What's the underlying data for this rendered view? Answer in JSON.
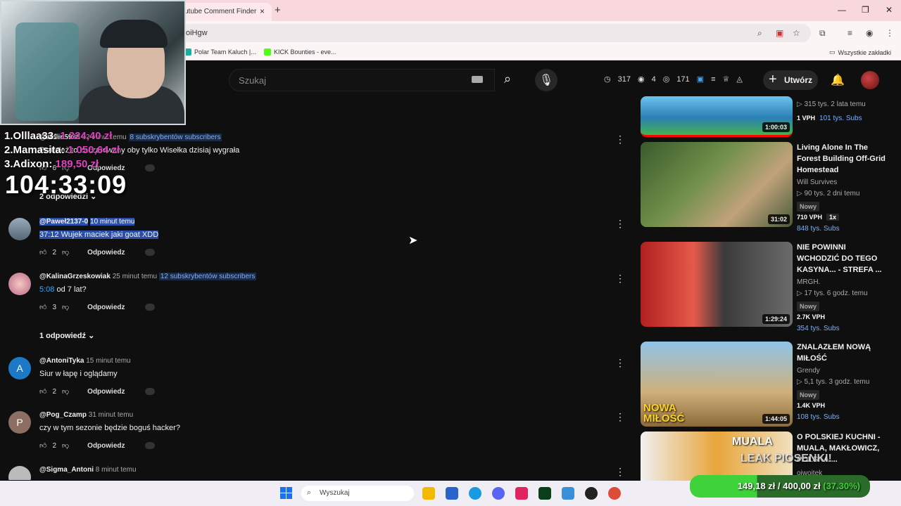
{
  "browser": {
    "tab_title": "utube Comment Finder",
    "address": "oiHgw",
    "bookmarks": [
      "Polar Team Kaluch |...",
      "KICK Bounties - eve..."
    ],
    "all_bookmarks": "Wszystkie zakładki"
  },
  "overlay": {
    "leaderboard": [
      {
        "name": "1.Olllaa33:",
        "amount": "1 324,40 zł"
      },
      {
        "name": "2.Mamasita:",
        "amount": "1 050,64 zł"
      },
      {
        "name": "3.Adixon:",
        "amount": "189,50 zł"
      }
    ],
    "timer": "104:33:09",
    "goal": {
      "current": "149,18 zł",
      "target": "400,00 zł",
      "percent": "(37.30%)",
      "progress": 0.373
    },
    "leak_text": "LEAK PIOSENKI!"
  },
  "header": {
    "search_placeholder": "Szukaj",
    "stats": {
      "a": "317",
      "b": "4",
      "c": "171"
    },
    "create_label": "Utwórz"
  },
  "comments": [
    {
      "author": "@ziolin5939",
      "time": "52 minut temu",
      "subs": "8 subskrybentów subscribers",
      "text": "Przecież to zaczarowany oby tylko Wisełka dzisiaj wygrała",
      "likes": "6",
      "reply": "Odpowiedz",
      "replies": "2 odpowiedzi"
    },
    {
      "author": "@Paweł2137-0",
      "time": "10 minut temu",
      "ts": "37:12",
      "text": " Wujek maciek jaki goat XDD",
      "likes": "2",
      "reply": "Odpowiedz"
    },
    {
      "author": "@KalinaGrzeskowiak",
      "time": "25 minut temu",
      "subs": "12 subskrybentów subscribers",
      "ts": "5:08",
      "text": " od 7 lat?",
      "likes": "3",
      "reply": "Odpowiedz",
      "replies": "1 odpowiedź"
    },
    {
      "author": "@AntoniTyka",
      "time": "15 minut temu",
      "initial": "A",
      "text": "Siur w łapę i oglądamy",
      "likes": "2",
      "reply": "Odpowiedz"
    },
    {
      "author": "@Pog_Czamp",
      "time": "31 minut temu",
      "initial": "P",
      "text": "czy w tym sezonie będzie boguś hacker?",
      "likes": "2",
      "reply": "Odpowiedz"
    },
    {
      "author": "@Sigma_Antoni",
      "time": "8 minut temu"
    }
  ],
  "videos": [
    {
      "duration": "1:00:03",
      "meta": "315 tys.  2 lata temu",
      "vph": "1 VPH",
      "subs": "101 tys.",
      "subs_suffix": "Subs"
    },
    {
      "title": "Living Alone In The Forest Building Off-Grid Homestead",
      "channel": "Will Survives",
      "meta": "90 tys.  2 dni temu",
      "badge": "Nowy",
      "vph": "710 VPH",
      "mult": "1x",
      "subs": "848 tys.",
      "subs_suffix": "Subs",
      "duration": "31:02"
    },
    {
      "title": "NIE POWINNI WCHODZIĆ DO TEGO KASYNA... - STREFA ...",
      "channel": "MRGH.",
      "meta": "17 tys.  6 godz. temu",
      "badge": "Nowy",
      "vph": "2.7K VPH",
      "subs": "354 tys.",
      "subs_suffix": "Subs",
      "duration": "1:29:24"
    },
    {
      "title": "ZNALAZŁEM NOWĄ MIŁOŚĆ",
      "channel": "Grendy",
      "meta": "5,1 tys.  3 godz. temu",
      "badge": "Nowy",
      "vph": "1.4K VPH",
      "subs": "108 tys.",
      "subs_suffix": "Subs",
      "duration": "1:44:05",
      "thumb_text": "NOWA MIŁOŚĆ"
    },
    {
      "title": "O POLSKIEJ KUCHNI - MUALA, MAKŁOWICZ, POLSKA ...",
      "channel": "ojwojtek",
      "thumb_text": "MUALA"
    }
  ],
  "taskbar": {
    "search_placeholder": "Wyszukaj"
  }
}
